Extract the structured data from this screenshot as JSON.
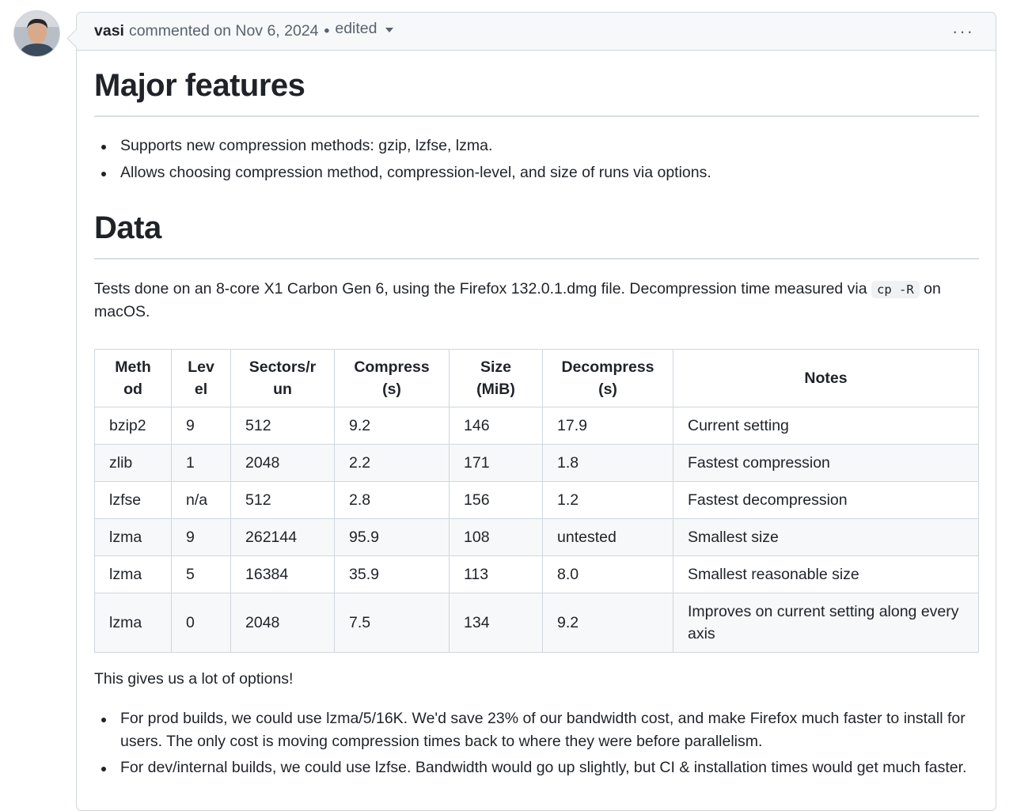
{
  "header": {
    "author": "vasi",
    "action_text": "commented on Nov 6, 2024",
    "separator": "•",
    "edited_label": "edited",
    "more_label": "···"
  },
  "sections": {
    "features_heading": "Major features",
    "features": [
      "Supports new compression methods: gzip, lzfse, lzma.",
      "Allows choosing compression method, compression-level, and size of runs via options."
    ],
    "data_heading": "Data",
    "tests_text_before": "Tests done on an 8-core X1 Carbon Gen 6, using the Firefox 132.0.1.dmg file. Decompression time measured via",
    "tests_code": "cp -R",
    "tests_text_after": "on macOS."
  },
  "table": {
    "headers": [
      "Meth od",
      "Lev el",
      "Sectors/r un",
      "Compress (s)",
      "Size (MiB)",
      "Decompress (s)",
      "Notes"
    ],
    "header_lines": [
      [
        "Meth",
        "od"
      ],
      [
        "Lev",
        "el"
      ],
      [
        "Sectors/r",
        "un"
      ],
      [
        "Compress",
        "(s)"
      ],
      [
        "Size",
        "(MiB)"
      ],
      [
        "Decompress",
        "(s)"
      ],
      [
        "Notes"
      ]
    ],
    "rows": [
      [
        "bzip2",
        "9",
        "512",
        "9.2",
        "146",
        "17.9",
        "Current setting"
      ],
      [
        "zlib",
        "1",
        "2048",
        "2.2",
        "171",
        "1.8",
        "Fastest compression"
      ],
      [
        "lzfse",
        "n/a",
        "512",
        "2.8",
        "156",
        "1.2",
        "Fastest decompression"
      ],
      [
        "lzma",
        "9",
        "262144",
        "95.9",
        "108",
        "untested",
        "Smallest size"
      ],
      [
        "lzma",
        "5",
        "16384",
        "35.9",
        "113",
        "8.0",
        "Smallest reasonable size"
      ],
      [
        "lzma",
        "0",
        "2048",
        "7.5",
        "134",
        "9.2",
        "Improves on current setting along every axis"
      ]
    ]
  },
  "closing": {
    "options_text": "This gives us a lot of options!",
    "bullets": [
      "For prod builds, we could use lzma/5/16K. We'd save 23% of our bandwidth cost, and make Firefox much faster to install for users. The only cost is moving compression times back to where they were before parallelism.",
      "For dev/internal builds, we could use lzfse. Bandwidth would go up slightly, but CI & installation times would get much faster."
    ]
  }
}
